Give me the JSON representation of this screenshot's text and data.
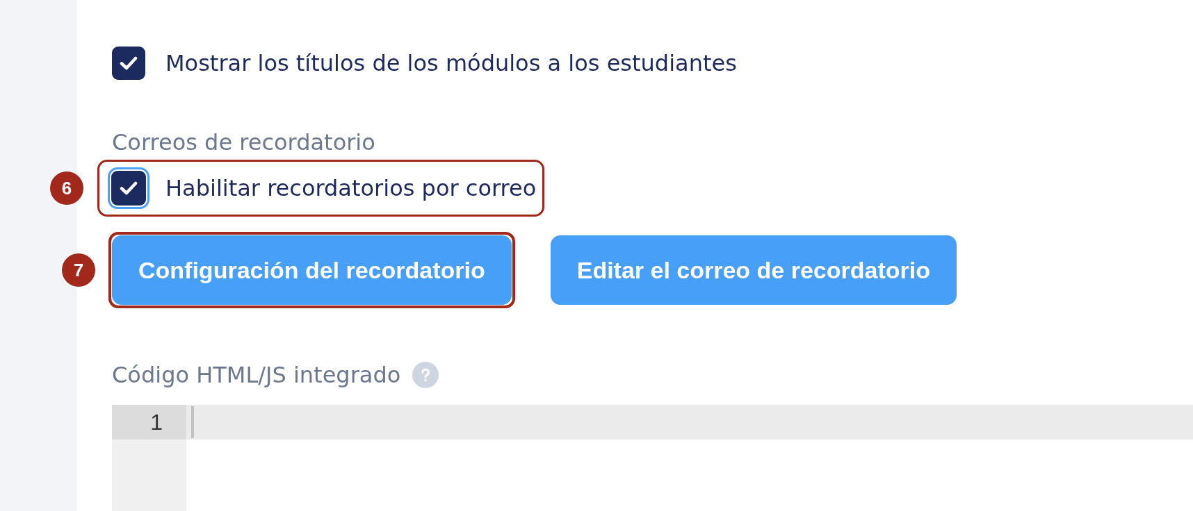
{
  "options": [
    {
      "label": "Mostrar los títulos de los módulos a los estudiantes",
      "checked": true,
      "focused": false
    }
  ],
  "reminder_emails": {
    "heading": "Correos de recordatorio",
    "option": {
      "label": "Habilitar recordatorios por correo",
      "checked": true,
      "focused": true,
      "callout": "6"
    },
    "buttons": [
      {
        "label": "Configuración del recordatorio",
        "callout": "7"
      },
      {
        "label": "Editar el correo de recordatorio"
      }
    ]
  },
  "embed_code": {
    "label": "Código HTML/JS integrado",
    "editor": {
      "lines": [
        {
          "number": "1",
          "active": true
        }
      ]
    }
  }
}
